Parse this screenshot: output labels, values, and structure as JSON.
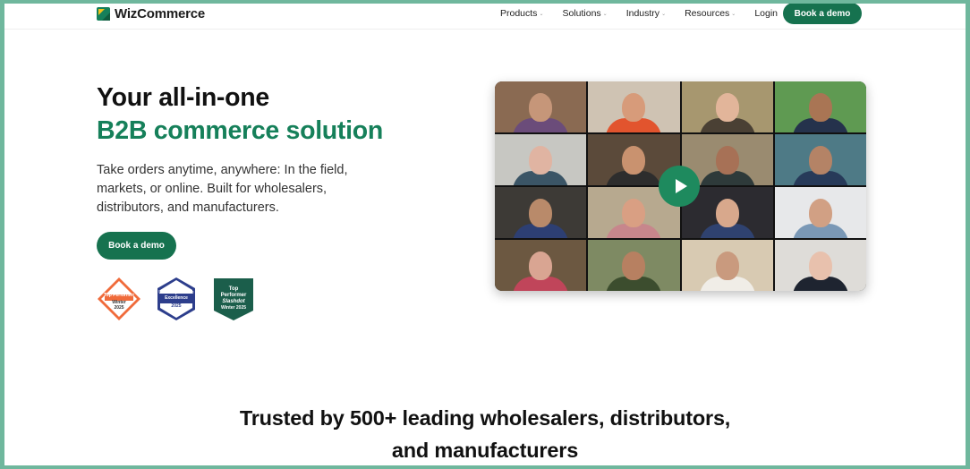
{
  "brand": {
    "name": "WizCommerce",
    "accent": "#16724f",
    "heading_green": "#16805a"
  },
  "nav": {
    "items": [
      {
        "label": "Products",
        "has_dropdown": true
      },
      {
        "label": "Solutions",
        "has_dropdown": true
      },
      {
        "label": "Industry",
        "has_dropdown": true
      },
      {
        "label": "Resources",
        "has_dropdown": true
      },
      {
        "label": "Login",
        "has_dropdown": false
      }
    ],
    "cta_label": "Book a demo"
  },
  "hero": {
    "title_line1": "Your all-in-one",
    "title_line2": "B2B commerce solution",
    "description": "Take orders anytime, anywhere: In the field, markets, or online. Built for wholesalers, distributors, and manufacturers.",
    "cta_label": "Book a demo"
  },
  "badges": [
    {
      "icon": "g2-top-performer-badge",
      "lines": [
        "Top Performer",
        "Winter",
        "2025"
      ],
      "color": "#f06b3b"
    },
    {
      "icon": "softwarereviews-ux-excellence-badge",
      "lines": [
        "User Experience",
        "Excellence",
        "2025"
      ],
      "color": "#2d3e8c"
    },
    {
      "icon": "slashdot-top-performer-badge",
      "lines": [
        "Top",
        "Performer",
        "Slashdot",
        "Winter 2025"
      ],
      "color": "#1b5e4b"
    }
  ],
  "video": {
    "icon": "play-icon",
    "tiles": [
      {
        "bg": "#8a6a52",
        "skin": "#c69679",
        "shirt": "#6b4c7a"
      },
      {
        "bg": "#cfc3b3",
        "skin": "#d79b7a",
        "shirt": "#e2542e"
      },
      {
        "bg": "#a7976f",
        "skin": "#e2b59a",
        "shirt": "#4a4034"
      },
      {
        "bg": "#5f9a52",
        "skin": "#a97554",
        "shirt": "#25324c"
      },
      {
        "bg": "#c7c7c2",
        "skin": "#e0b4a2",
        "shirt": "#3b5566"
      },
      {
        "bg": "#5b4a3a",
        "skin": "#c9926f",
        "shirt": "#2d2d2d"
      },
      {
        "bg": "#9a8b70",
        "skin": "#a77156",
        "shirt": "#2e3a3a"
      },
      {
        "bg": "#4e7a86",
        "skin": "#b48366",
        "shirt": "#273a59"
      },
      {
        "bg": "#3d3a36",
        "skin": "#b98a6a",
        "shirt": "#2d3f73"
      },
      {
        "bg": "#b7a98f",
        "skin": "#d99f83",
        "shirt": "#c7868c"
      },
      {
        "bg": "#2c2b30",
        "skin": "#d8a88c",
        "shirt": "#2f4270"
      },
      {
        "bg": "#e7e8ea",
        "skin": "#d1a084",
        "shirt": "#7a98b6"
      },
      {
        "bg": "#6c5841",
        "skin": "#d9a592",
        "shirt": "#c0455a"
      },
      {
        "bg": "#7e8a63",
        "skin": "#b78061",
        "shirt": "#3c4d2e"
      },
      {
        "bg": "#d8cab2",
        "skin": "#c99a7e",
        "shirt": "#f0ede7"
      },
      {
        "bg": "#dedcd8",
        "skin": "#e8c1ad",
        "shirt": "#1e2430"
      }
    ]
  },
  "trusted": {
    "line1": "Trusted by 500+ leading wholesalers, distributors,",
    "line2": "and manufacturers"
  }
}
